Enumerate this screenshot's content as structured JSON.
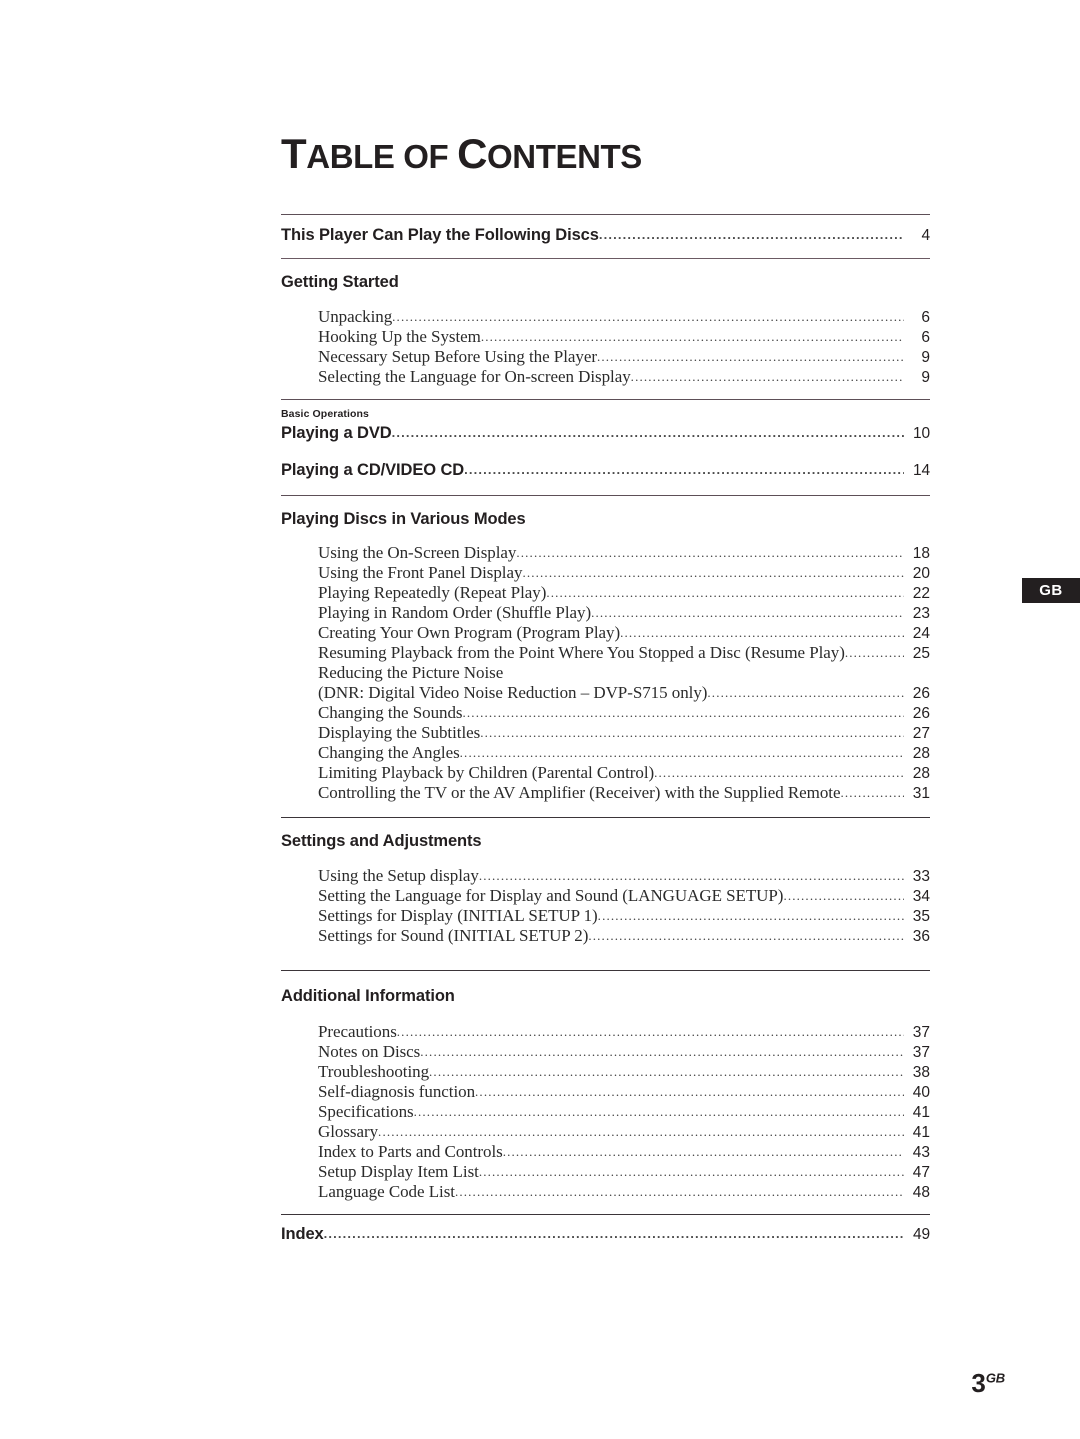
{
  "document": {
    "title_lead": "T",
    "title_rest_a": "ABLE",
    "title_sep": " OF ",
    "title_cap_c": "C",
    "title_rest_b": "ONTENTS",
    "title_full": "TABLE OF CONTENTS",
    "margin_tab": "GB",
    "folio_number": "3",
    "folio_suffix": "GB"
  },
  "entries": {
    "discs": {
      "label": "This Player Can Play the Following Discs",
      "page": "4"
    }
  },
  "sections": [
    {
      "heading": "Getting Started",
      "kicker": "",
      "items": [
        {
          "label": "Unpacking",
          "page": "6"
        },
        {
          "label": "Hooking Up the System",
          "page": "6"
        },
        {
          "label": "Necessary Setup Before Using the Player",
          "page": "9"
        },
        {
          "label": "Selecting the Language for On-screen Display",
          "page": "9"
        }
      ]
    },
    {
      "heading": "",
      "kicker": "Basic Operations",
      "majors": [
        {
          "label": "Playing a DVD",
          "page": "10"
        },
        {
          "label": "Playing a CD/VIDEO CD",
          "page": "14"
        }
      ]
    },
    {
      "heading": "Playing Discs in Various Modes",
      "kicker": "",
      "items": [
        {
          "label": "Using the On-Screen Display",
          "page": "18"
        },
        {
          "label": "Using the Front Panel Display",
          "page": "20"
        },
        {
          "label": "Playing Repeatedly (Repeat Play)",
          "page": "22"
        },
        {
          "label": "Playing in Random Order (Shuffle Play)",
          "page": "23"
        },
        {
          "label": "Creating Your Own Program (Program Play)",
          "page": "24"
        },
        {
          "label": "Resuming Playback from the Point Where You Stopped a Disc (Resume Play)",
          "page": "25"
        },
        {
          "label": "Reducing the Picture Noise",
          "page": ""
        },
        {
          "label": "(DNR: Digital Video Noise Reduction – DVP-S715 only)",
          "page": "26"
        },
        {
          "label": "Changing the Sounds",
          "page": "26"
        },
        {
          "label": "Displaying the Subtitles",
          "page": "27"
        },
        {
          "label": "Changing the Angles",
          "page": "28"
        },
        {
          "label": "Limiting Playback by Children (Parental Control)",
          "page": "28"
        },
        {
          "label": "Controlling the TV or the AV Amplifier (Receiver) with the Supplied Remote",
          "page": "31"
        }
      ]
    },
    {
      "heading": "Settings and Adjustments",
      "kicker": "",
      "items": [
        {
          "label": "Using the Setup display",
          "page": "33"
        },
        {
          "label": "Setting the Language for Display and Sound (LANGUAGE SETUP)",
          "page": "34"
        },
        {
          "label": "Settings for Display (INITIAL SETUP 1)",
          "page": "35"
        },
        {
          "label": "Settings for Sound (INITIAL SETUP 2)",
          "page": "36"
        }
      ]
    },
    {
      "heading": "Additional Information",
      "kicker": "",
      "items": [
        {
          "label": "Precautions",
          "page": "37"
        },
        {
          "label": "Notes on Discs",
          "page": "37"
        },
        {
          "label": "Troubleshooting",
          "page": "38"
        },
        {
          "label": "Self-diagnosis function",
          "page": "40"
        },
        {
          "label": "Specifications",
          "page": "41"
        },
        {
          "label": "Glossary",
          "page": "41"
        },
        {
          "label": "Index to Parts and Controls",
          "page": "43"
        },
        {
          "label": "Setup Display Item List",
          "page": "47"
        },
        {
          "label": "Language Code List",
          "page": "48"
        }
      ]
    }
  ],
  "index_entry": {
    "label": "Index",
    "page": "49"
  }
}
